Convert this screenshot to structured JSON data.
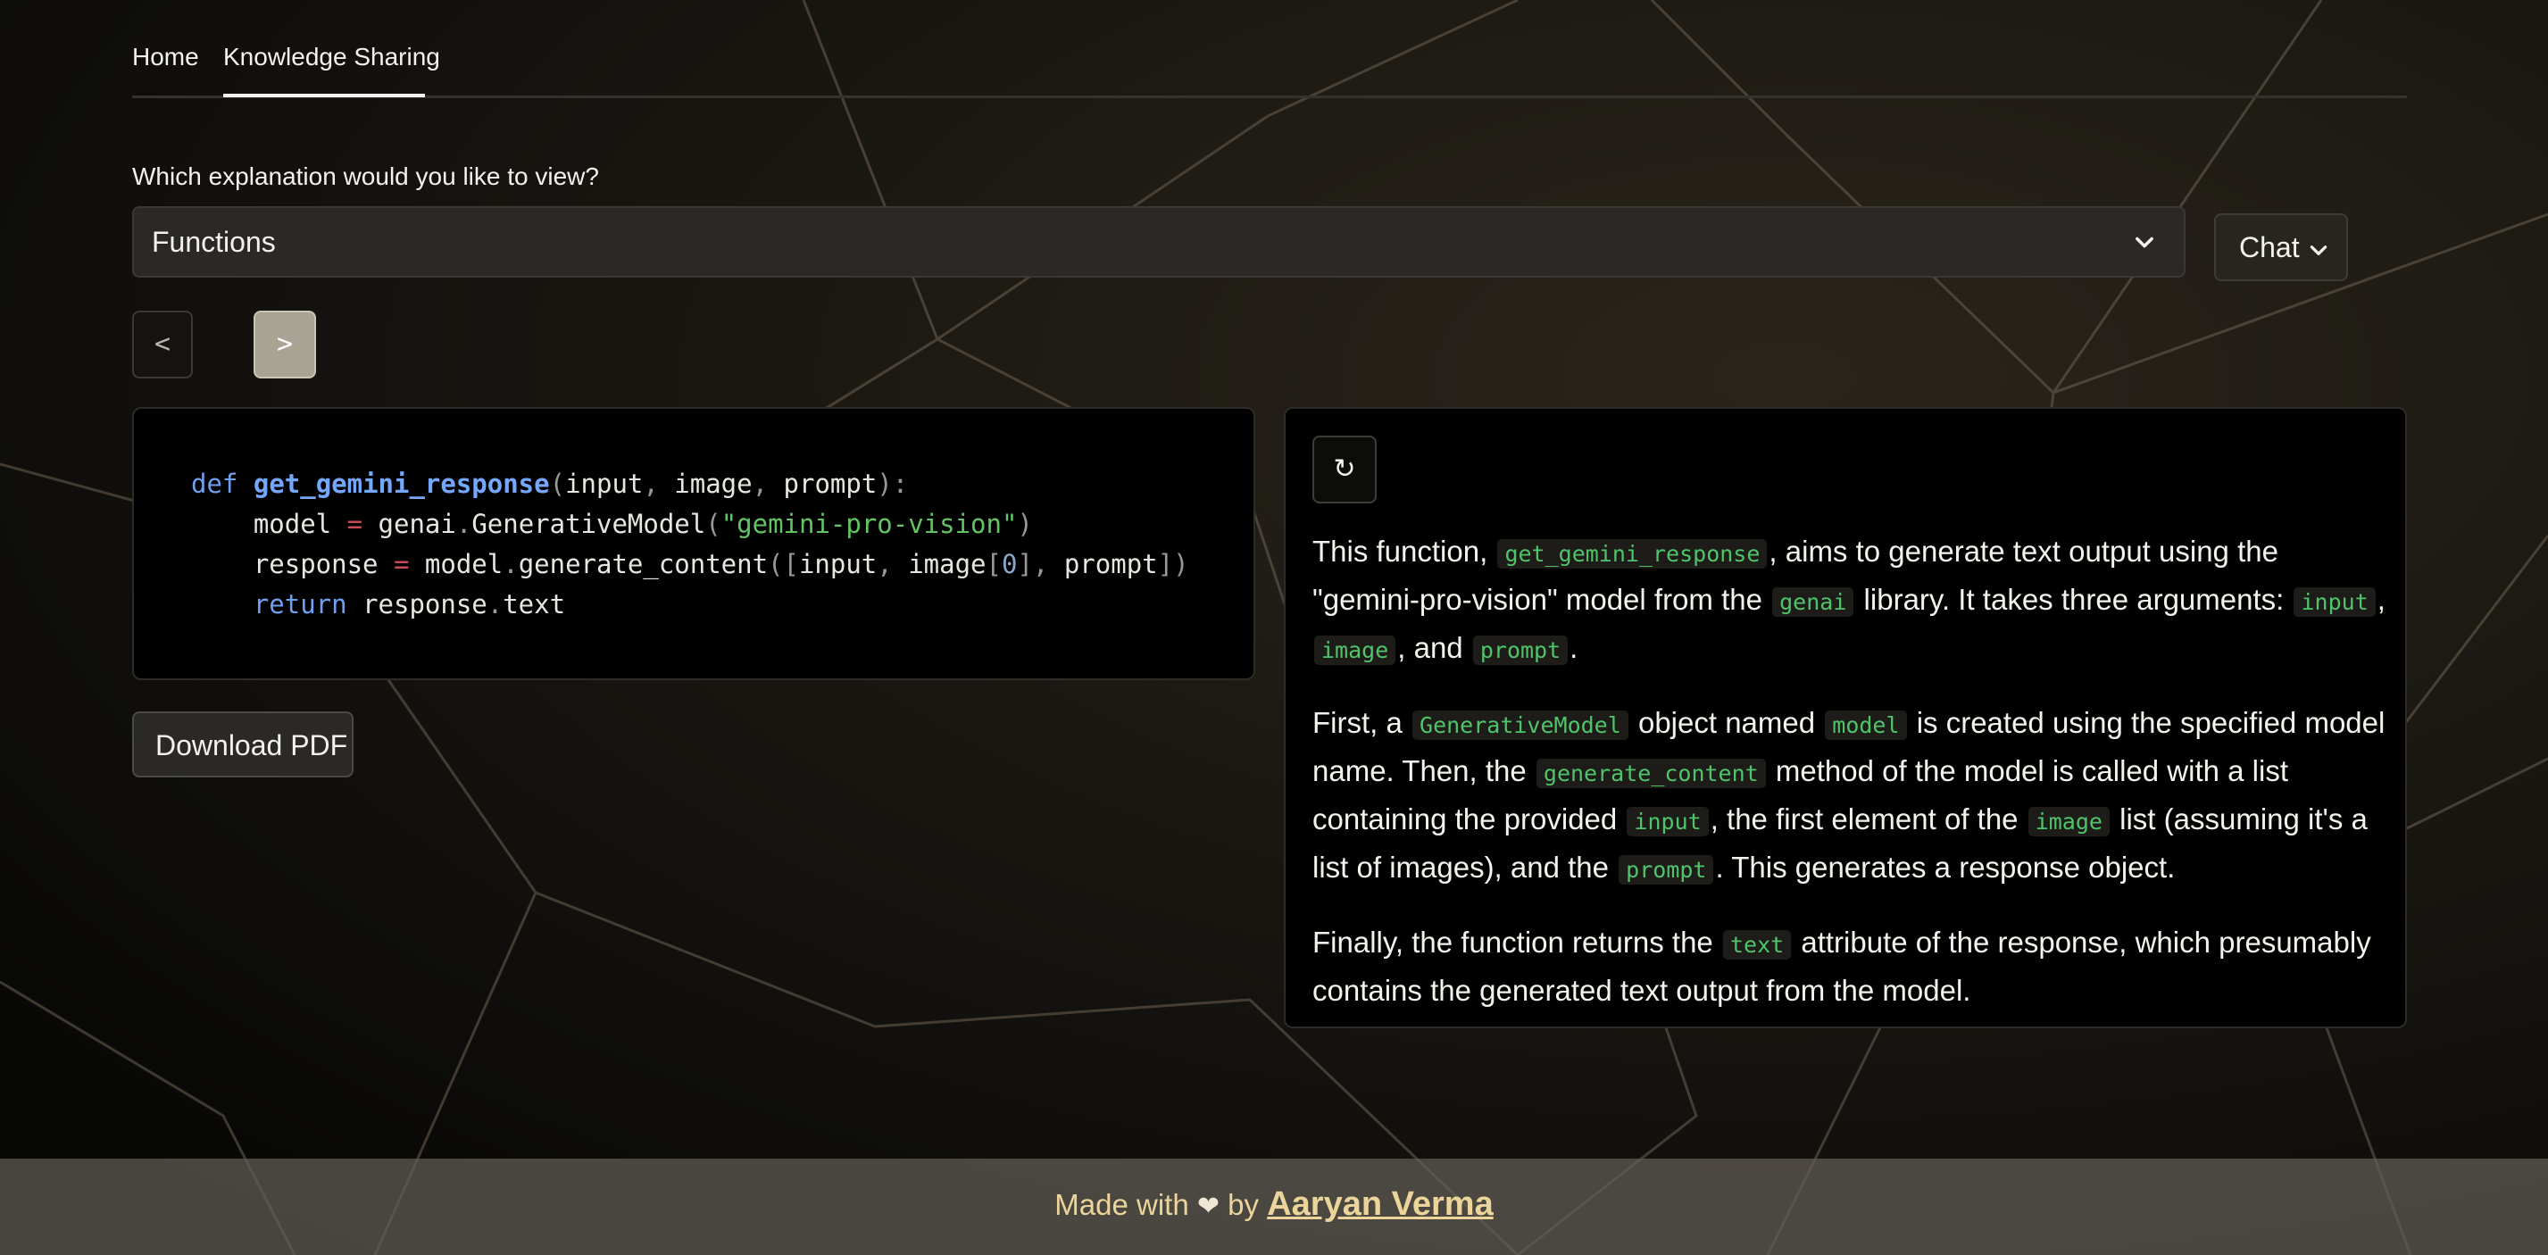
{
  "nav": {
    "tabs": [
      {
        "label": "Home"
      },
      {
        "label": "Knowledge Sharing"
      }
    ]
  },
  "question": "Which explanation would you like to view?",
  "select": {
    "value": "Functions",
    "icon": "chevron-down-icon"
  },
  "chat": {
    "label": "Chat",
    "icon": "chevron-down-icon"
  },
  "pager": {
    "prev": "<",
    "next": ">"
  },
  "code": {
    "line1": {
      "kw": "def",
      "fn": "get_gemini_response",
      "p1": "(",
      "a1": "input",
      "c1": ",",
      "a2": " image",
      "c2": ",",
      "a3": " prompt",
      "p2": "):"
    },
    "line2": {
      "ind": "    ",
      "a": "model ",
      "op": "=",
      "b": " genai",
      "dot": ".",
      "c": "GenerativeModel",
      "p1": "(",
      "str": "\"gemini-pro-vision\"",
      "p2": ")"
    },
    "line3": {
      "ind": "    ",
      "a": "response ",
      "op": "=",
      "b": " model",
      "dot": ".",
      "c": "generate_content",
      "p1": "([",
      "d": "input",
      "cm": ",",
      "e": " image",
      "br1": "[",
      "num": "0",
      "br2": "]",
      "cm2": ",",
      "f": " prompt",
      "p2": "])"
    },
    "line4": {
      "ind": "    ",
      "kw": "return",
      "a": " response",
      "dot": ".",
      "b": "text"
    }
  },
  "download": {
    "label": "Download PDF"
  },
  "refresh": {
    "label": "↻",
    "icon": "refresh-icon"
  },
  "explanation": {
    "p1": {
      "t1": "This function, ",
      "c1": "get_gemini_response",
      "t2": ", aims to generate text output using the \"gemini-pro-vision\" model from the ",
      "c2": "genai",
      "t3": " library. It takes three arguments: ",
      "c3": "input",
      "t4": ", ",
      "c4": "image",
      "t5": ", and ",
      "c5": "prompt",
      "t6": "."
    },
    "p2": {
      "t1": "First, a ",
      "c1": "GenerativeModel",
      "t2": " object named ",
      "c2": "model",
      "t3": " is created using the specified model name. Then, the ",
      "c3": "generate_content",
      "t4": " method of the model is called with a list containing the provided ",
      "c4": "input",
      "t5": ", the first element of the ",
      "c5": "image",
      "t6": " list (assuming it's a list of images), and the ",
      "c6": "prompt",
      "t7": ". This generates a response object."
    },
    "p3": {
      "t1": "Finally, the function returns the ",
      "c1": "text",
      "t2": " attribute of the response, which presumably contains the generated text output from the model."
    }
  },
  "footer": {
    "made_with": "Made with",
    "heart": "❤",
    "by": "by",
    "author": "Aaryan Verma"
  }
}
